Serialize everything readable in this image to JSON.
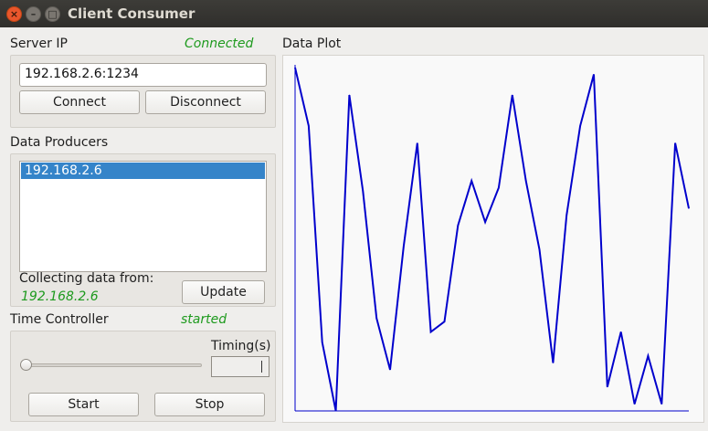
{
  "window": {
    "title": "Client Consumer",
    "close_glyph": "×",
    "min_glyph": "–",
    "max_glyph": "□"
  },
  "server": {
    "label": "Server IP",
    "status": "Connected",
    "ip_value": "192.168.2.6:1234",
    "connect_label": "Connect",
    "disconnect_label": "Disconnect"
  },
  "producers": {
    "label": "Data Producers",
    "items": [
      "192.168.2.6"
    ],
    "collecting_label": "Collecting data from:",
    "collecting_value": "192.168.2.6",
    "update_label": "Update"
  },
  "timer": {
    "label": "Time Controller",
    "status": "started",
    "timing_label": "Timing(s)",
    "slider_value": 0,
    "start_label": "Start",
    "stop_label": "Stop"
  },
  "plot": {
    "label": "Data Plot",
    "line_color": "#0000cc",
    "background": "#f9f9f9"
  },
  "chart_data": {
    "type": "line",
    "title": "",
    "xlabel": "",
    "ylabel": "",
    "ylim": [
      0,
      100
    ],
    "series": [
      {
        "values": [
          100,
          83,
          20,
          0,
          92,
          64,
          27,
          12,
          48,
          78,
          23,
          26,
          54,
          67,
          55,
          65,
          92,
          67,
          47,
          14,
          57,
          83,
          98,
          7,
          23,
          2,
          16,
          2,
          78,
          59
        ]
      }
    ]
  }
}
